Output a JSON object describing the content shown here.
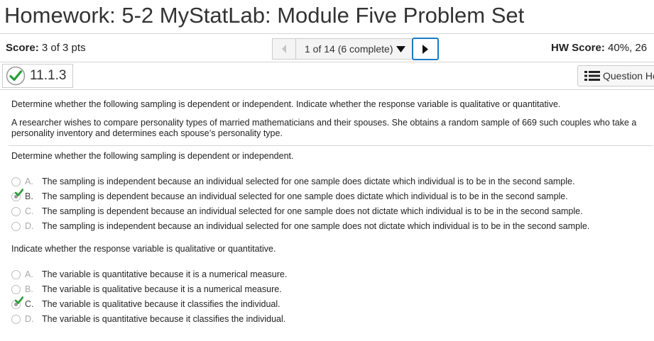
{
  "header": {
    "title": "Homework: 5-2 MyStatLab: Module Five Problem Set"
  },
  "scorebar": {
    "score_label": "Score:",
    "score_value": "3 of 3 pts",
    "nav_position": "1 of 14 (6 complete)",
    "hw_score_label": "HW Score:",
    "hw_score_value": "40%, 26"
  },
  "question": {
    "id": "11.1.3",
    "help_label": "Question He",
    "status": "correct",
    "accent_color": "#2a9d3a"
  },
  "content": {
    "instruction": "Determine whether the following sampling is dependent or independent. Indicate whether the response variable is qualitative or quantitative.",
    "scenario": "A researcher wishes to compare personality types of married mathematicians and their spouses. She obtains a random sample of 669 such couples who take a personality inventory and determines each spouse’s personality type.",
    "part1_prompt": "Determine whether the following sampling is dependent or independent.",
    "part1_options": [
      {
        "letter": "A.",
        "text": "The sampling is independent because an individual selected for one sample does dictate which individual is to be in the second sample.",
        "selected": false
      },
      {
        "letter": "B.",
        "text": "The sampling is dependent because an individual selected for one sample does dictate which individual is to be in the second sample.",
        "selected": true
      },
      {
        "letter": "C.",
        "text": "The sampling is dependent because an individual selected for one sample does not dictate which individual is to be in the second sample.",
        "selected": false
      },
      {
        "letter": "D.",
        "text": "The sampling is independent because an individual selected for one sample does not dictate which individual is to be in the second sample.",
        "selected": false
      }
    ],
    "part2_prompt": "Indicate whether the response variable is qualitative or quantitative.",
    "part2_options": [
      {
        "letter": "A.",
        "text": "The variable is quantitative because it is a numerical measure.",
        "selected": false
      },
      {
        "letter": "B.",
        "text": "The variable is qualitative because it is a numerical measure.",
        "selected": false
      },
      {
        "letter": "C.",
        "text": "The variable is qualitative because it classifies the individual.",
        "selected": true
      },
      {
        "letter": "D.",
        "text": "The variable is quantitative because it classifies the individual.",
        "selected": false
      }
    ]
  }
}
